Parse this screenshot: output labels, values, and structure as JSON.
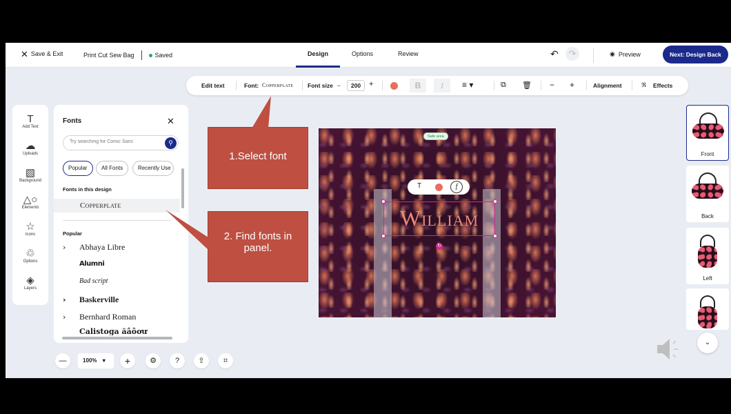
{
  "header": {
    "save_exit": "Save & Exit",
    "project_name": "Print Cut Sew Bag",
    "saved": "Saved",
    "tabs": [
      "Design",
      "Options",
      "Review"
    ],
    "preview": "Preview",
    "next": "Next: Design Back"
  },
  "toolbar": {
    "edit_text": "Edit text",
    "font_label": "Font:",
    "font_value": "Copperplate",
    "font_size_label": "Font size",
    "font_size": "200",
    "minus": "−",
    "plus": "+",
    "bold": "B",
    "italic": "I",
    "alignment": "Alignment",
    "effects": "Effects",
    "text_color": "#ea6d64"
  },
  "rail": {
    "items": [
      {
        "label": "Add Text",
        "icon": "text-icon"
      },
      {
        "label": "Uploads",
        "icon": "upload-cloud-icon"
      },
      {
        "label": "Background",
        "icon": "image-icon"
      },
      {
        "label": "Elements",
        "icon": "shapes-icon"
      },
      {
        "label": "Icons",
        "icon": "star-icon"
      },
      {
        "label": "Options",
        "icon": "shirt-icon"
      },
      {
        "label": "Layers",
        "icon": "layers-icon"
      }
    ]
  },
  "fonts_panel": {
    "title": "Fonts",
    "search_placeholder": "Try searching for Comic Sans",
    "chips": [
      "Popular",
      "All Fonts",
      "Recently Use"
    ],
    "in_design_label": "Fonts in this design",
    "in_design_font": "Copperplate",
    "popular_label": "Popular",
    "popular_fonts": [
      "Abhaya Libre",
      "Alumni",
      "Bad script",
      "Baskerville",
      "Bernhard Roman",
      "Calistoga ăâôơư"
    ]
  },
  "callouts": {
    "step1": "1.Select font",
    "step2": "2. Find fonts in panel."
  },
  "canvas": {
    "safe_area": "Safe area",
    "text": "William"
  },
  "zoom": {
    "value": "100%"
  },
  "views": [
    "Front",
    "Back",
    "Left"
  ]
}
